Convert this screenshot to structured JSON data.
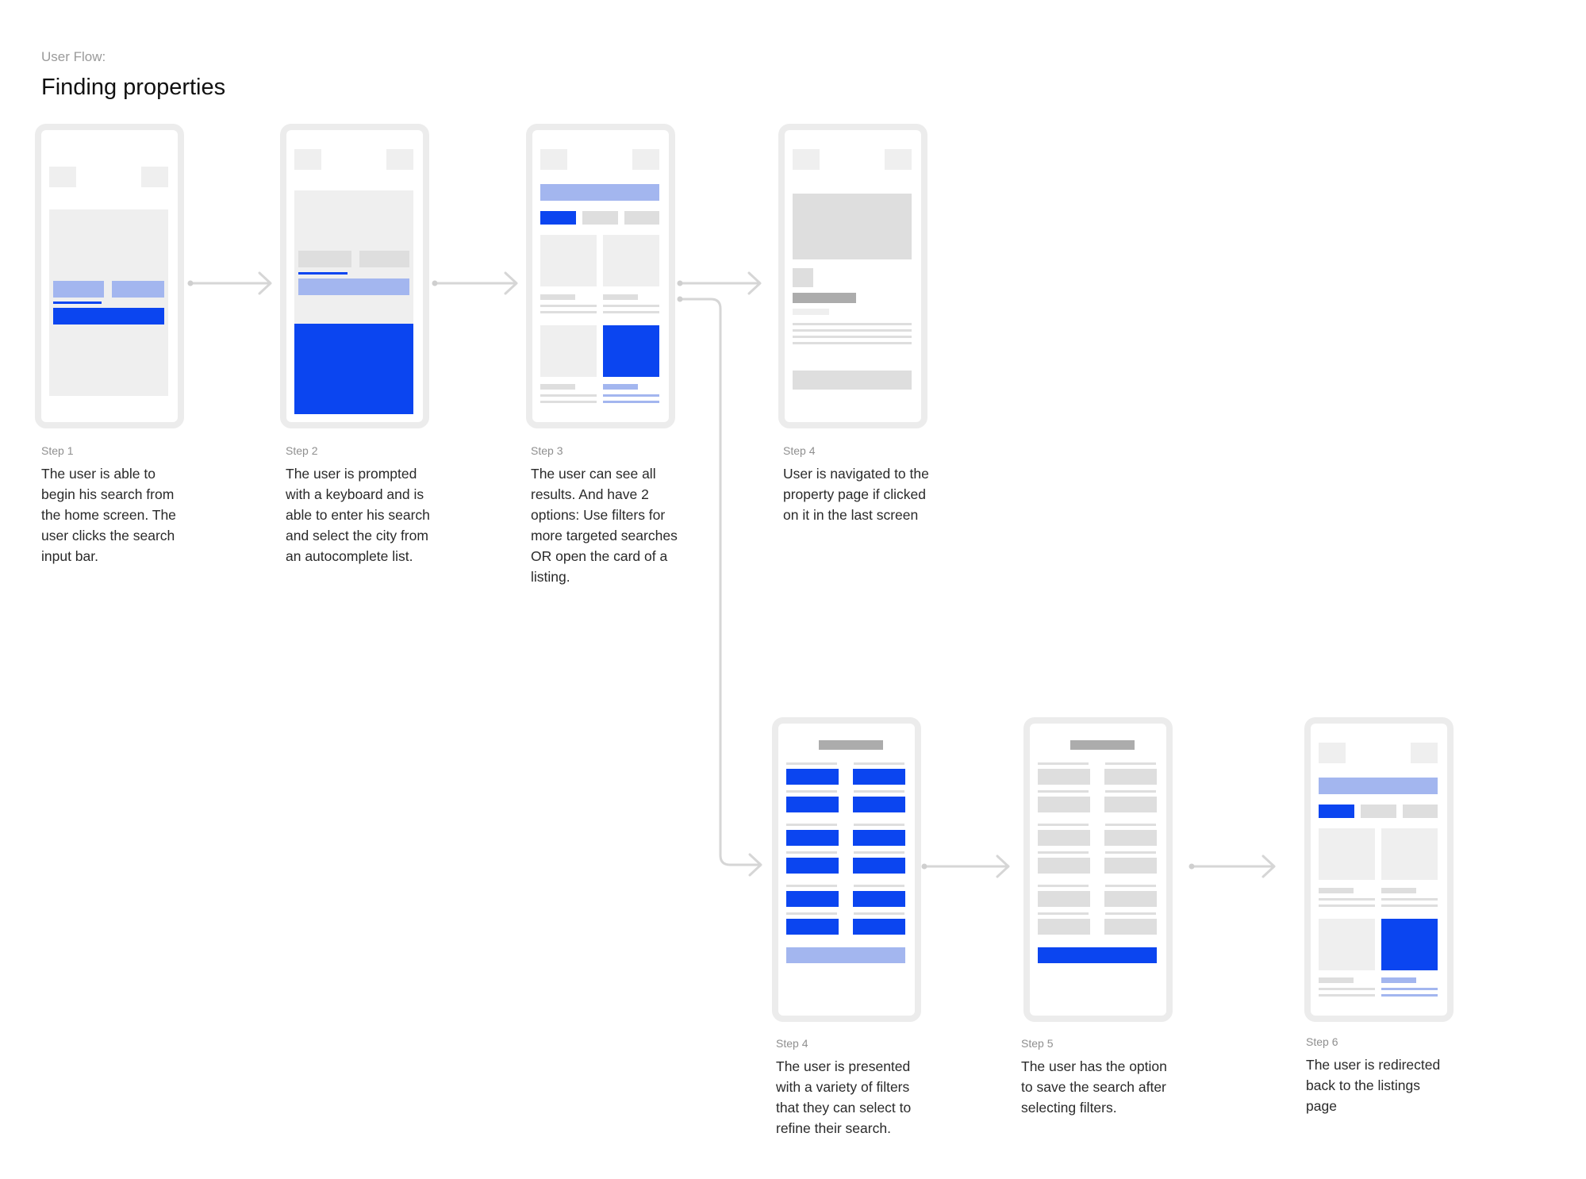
{
  "header": {
    "kicker": "User Flow:",
    "title": "Finding properties"
  },
  "steps": [
    {
      "label": "Step 1",
      "text": "The user is able to begin his search from the home screen. The user clicks the search input bar."
    },
    {
      "label": "Step 2",
      "text": "The user is prompted with a keyboard and is able to enter his search and select the city from an autocomplete list."
    },
    {
      "label": "Step 3",
      "text": "The user can see all results. And have 2 options: Use filters for more targeted searches OR open the card of a listing."
    },
    {
      "label": "Step 4",
      "text": "User is navigated to the property page if clicked on it in the last screen"
    },
    {
      "label": "Step 4",
      "text": "The user is presented with a variety of filters that they can select to refine their search."
    },
    {
      "label": "Step 5",
      "text": "The user has the option to save the search after selecting filters."
    },
    {
      "label": "Step 6",
      "text": "The user is redirected back to the listings page"
    }
  ],
  "colors": {
    "blue": "#0b45f0",
    "light_blue": "#a3b6ef",
    "placeholder": "#efefef",
    "frame": "#ececec",
    "connector": "#d6d6d6"
  }
}
